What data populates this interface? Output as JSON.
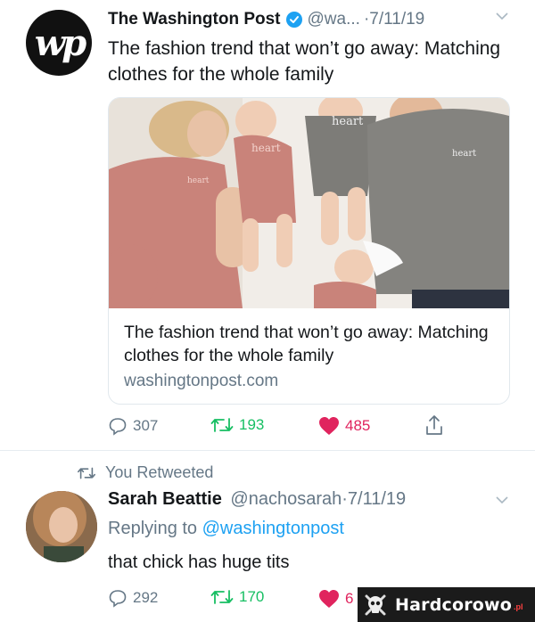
{
  "tweet1": {
    "avatar_text": "wp",
    "author_name": "The Washington Post",
    "handle": "@wa...",
    "date": "·7/11/19",
    "text": "The fashion trend that won’t go away: Matching clothes for the whole family",
    "card": {
      "title": "The fashion trend that won’t go away: Matching clothes for the whole family",
      "domain": "washingtonpost.com",
      "shirt_text": "heart you."
    },
    "replies": "307",
    "retweets": "193",
    "likes": "485"
  },
  "tweet2": {
    "retweet_label": "You Retweeted",
    "author_name": "Sarah Beattie",
    "handle": "@nachosarah",
    "date": "·7/11/19",
    "replying_prefix": "Replying to",
    "replying_to": "@washingtonpost",
    "text": "that chick has huge tits",
    "replies": "292",
    "retweets": "170",
    "likes": "6"
  },
  "watermark": {
    "brand": "Hardcorowo",
    "suffix": ".pl"
  },
  "colors": {
    "retweet_green": "#17bf63",
    "like_red": "#e0245e",
    "link_blue": "#1da1f2",
    "muted_gray": "#657786",
    "verified_blue": "#1da1f2"
  }
}
